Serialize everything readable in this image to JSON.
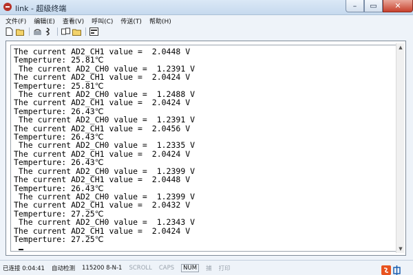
{
  "window": {
    "title": "link - 超级终端",
    "buttons": {
      "minimize": "–",
      "maximize": "▭",
      "close": "✕"
    }
  },
  "menu": [
    "文件(F)",
    "编辑(E)",
    "查看(V)",
    "呼叫(C)",
    "传送(T)",
    "帮助(H)"
  ],
  "toolbar": {
    "icons": [
      "new-file-icon",
      "open-folder-icon",
      "phone-icon",
      "disconnect-icon",
      "send-icon",
      "receive-icon",
      "properties-icon"
    ]
  },
  "terminal": {
    "lines": [
      "The current AD2_CH1 value =  2.0448 V",
      "Temperture: 25.81℃",
      " The current AD2_CH0 value =  1.2391 V",
      "The current AD2_CH1 value =  2.0424 V",
      "Temperture: 25.81℃",
      " The current AD2_CH0 value =  1.2488 V",
      "The current AD2_CH1 value =  2.0424 V",
      "Temperture: 26.43℃",
      " The current AD2_CH0 value =  1.2391 V",
      "The current AD2_CH1 value =  2.0456 V",
      "Temperture: 26.43℃",
      " The current AD2_CH0 value =  1.2335 V",
      "The current AD2_CH1 value =  2.0424 V",
      "Temperture: 26.43℃",
      " The current AD2_CH0 value =  1.2399 V",
      "The current AD2_CH1 value =  2.0448 V",
      "Temperture: 26.43℃",
      " The current AD2_CH0 value =  1.2399 V",
      "The current AD2_CH1 value =  2.0432 V",
      "Temperture: 27.25℃",
      " The current AD2_CH0 value =  1.2343 V",
      "The current AD2_CH1 value =  2.0424 V",
      "Temperture: 27.25℃"
    ]
  },
  "status": {
    "connected": "已连接 0:04:41",
    "detect": "自动检测",
    "baud": "115200 8-N-1",
    "scroll": "SCROLL",
    "caps": "CAPS",
    "num": "NUM",
    "capture": "捕",
    "print": "打印"
  },
  "colors": {
    "accent": "#c7402c",
    "chrome": "#eef3f9"
  }
}
